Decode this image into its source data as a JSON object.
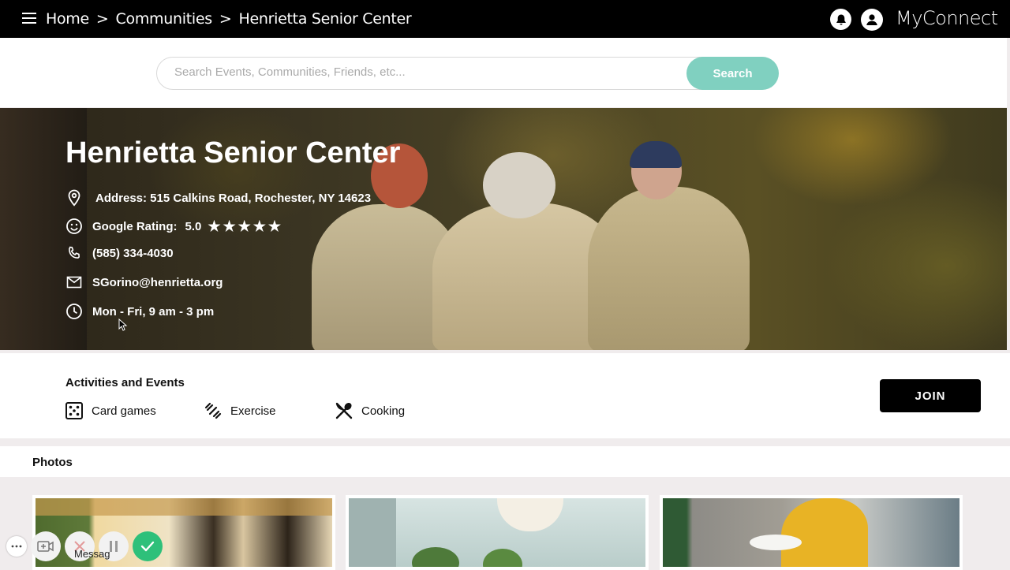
{
  "topbar": {
    "breadcrumbs": [
      "Home",
      "Communities",
      "Henrietta Senior Center"
    ],
    "separator": ">",
    "brand": "MyConnect",
    "icons": [
      "menu-icon",
      "bell-icon",
      "user-icon"
    ]
  },
  "search": {
    "placeholder": "Search Events, Communities, Friends, etc...",
    "button_label": "Search",
    "accent": "#80d0c0"
  },
  "center": {
    "name": "Henrietta Senior Center",
    "address": "Address: 515 Calkins Road, Rochester, NY 14623",
    "rating_label": "Google Rating:",
    "rating_value": "5.0",
    "rating_stars": "★★★★★",
    "phone": "(585) 334-4030",
    "email": "SGorino@henrietta.org",
    "hours": "Mon - Fri, 9 am - 3 pm"
  },
  "activities": {
    "title": "Activities and Events",
    "items": [
      {
        "label": "Card games",
        "icon": "dice-icon"
      },
      {
        "label": "Exercise",
        "icon": "dumbbell-icon"
      },
      {
        "label": "Cooking",
        "icon": "utensils-icon"
      }
    ],
    "join_label": "JOIN"
  },
  "photos": {
    "title": "Photos"
  },
  "controls": {
    "message_label": "Messag",
    "icons": [
      "more-icon",
      "video-add-icon",
      "close-icon",
      "pause-icon",
      "check-icon"
    ]
  }
}
